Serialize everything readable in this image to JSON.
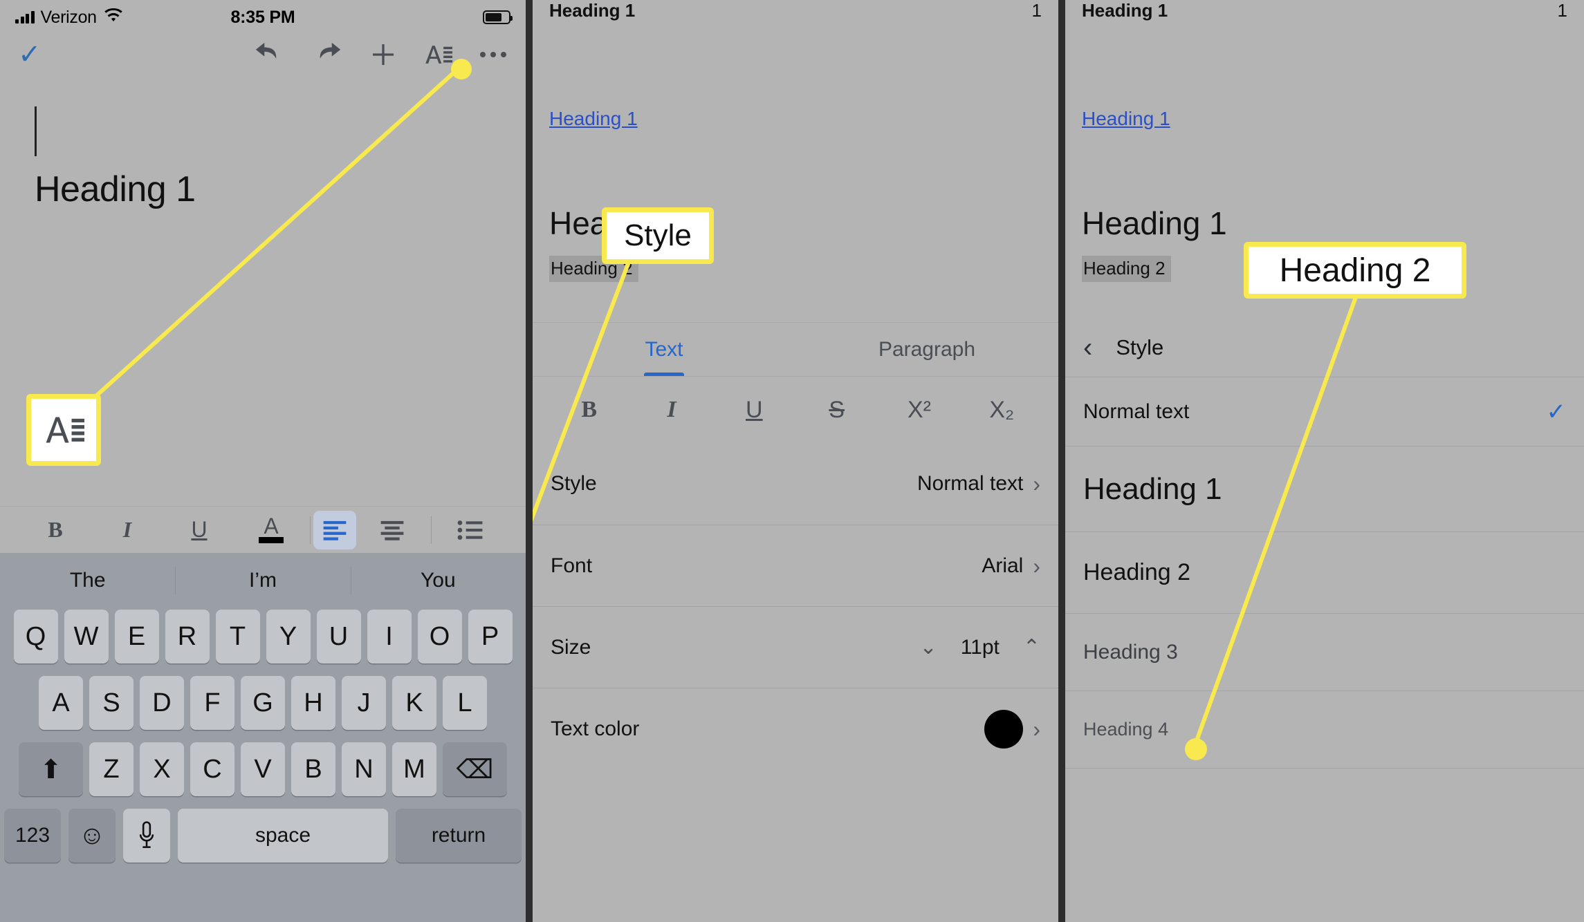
{
  "panel1": {
    "status": {
      "carrier": "Verizon",
      "time": "8:35 PM",
      "signal_icon": "cellular-signal-icon",
      "wifi_icon": "wifi-icon",
      "battery_icon": "battery-icon"
    },
    "toolbar": {
      "done_label": "✓",
      "undo_label": "undo-icon",
      "redo_label": "redo-icon",
      "add_label": "+",
      "format_label": "A",
      "more_label": "•••"
    },
    "document": {
      "heading_text": "Heading 1"
    },
    "format_bar": {
      "bold": "B",
      "italic": "I",
      "underline": "U",
      "text_color": "A",
      "align_left": "align-left-icon",
      "align_center": "align-center-icon",
      "bullet_list": "bulleted-list-icon"
    },
    "keyboard": {
      "predictions": [
        "The",
        "I’m",
        "You"
      ],
      "row1": [
        "Q",
        "W",
        "E",
        "R",
        "T",
        "Y",
        "U",
        "I",
        "O",
        "P"
      ],
      "row2": [
        "A",
        "S",
        "D",
        "F",
        "G",
        "H",
        "J",
        "K",
        "L"
      ],
      "row3": [
        "Z",
        "X",
        "C",
        "V",
        "B",
        "N",
        "M"
      ],
      "shift": "⬆",
      "backspace": "⌫",
      "numbers": "123",
      "emoji": "☺",
      "mic": "mic-icon",
      "space": "space",
      "return": "return"
    },
    "callout": {
      "label": "A"
    }
  },
  "panel2": {
    "doc_header": {
      "title": "Heading 1",
      "page": "1"
    },
    "link": "Heading 1",
    "sample": {
      "h1": "Heading 1",
      "h2": "Heading 2"
    },
    "tabs": [
      {
        "label": "Text",
        "active": true
      },
      {
        "label": "Paragraph",
        "active": false
      }
    ],
    "format_icons": {
      "bold": "B",
      "italic": "I",
      "underline": "U",
      "strikethrough": "S",
      "superscript": "X²",
      "subscript": "X₂"
    },
    "rows": [
      {
        "label": "Style",
        "value": "Normal text",
        "control": "chevron-right-icon"
      },
      {
        "label": "Font",
        "value": "Arial",
        "control": "chevron-right-icon"
      },
      {
        "label": "Size",
        "value": "11pt",
        "control": "stepper"
      },
      {
        "label": "Text color",
        "value": "",
        "control": "color-swatch"
      }
    ],
    "callout": {
      "label": "Style"
    }
  },
  "panel3": {
    "doc_header": {
      "title": "Heading 1",
      "page": "1"
    },
    "link": "Heading 1",
    "sample": {
      "h1": "Heading 1",
      "h2": "Heading 2"
    },
    "nav": {
      "back": "‹",
      "title": "Style"
    },
    "styles": [
      {
        "label": "Normal text",
        "selected": true
      },
      {
        "label": "Heading 1",
        "selected": false
      },
      {
        "label": "Heading 2",
        "selected": false
      },
      {
        "label": "Heading 3",
        "selected": false
      },
      {
        "label": "Heading 4",
        "selected": false
      }
    ],
    "check_mark": "✓",
    "callout": {
      "label": "Heading 2"
    }
  },
  "colors": {
    "panel_bg": "#b4b4b4",
    "callout_yellow": "#f7e94e",
    "accent_blue": "#2767c9",
    "keyboard_bg": "#9a9ea5",
    "key_bg": "#c2c5c9",
    "selection_gray": "#9e9e9e"
  }
}
